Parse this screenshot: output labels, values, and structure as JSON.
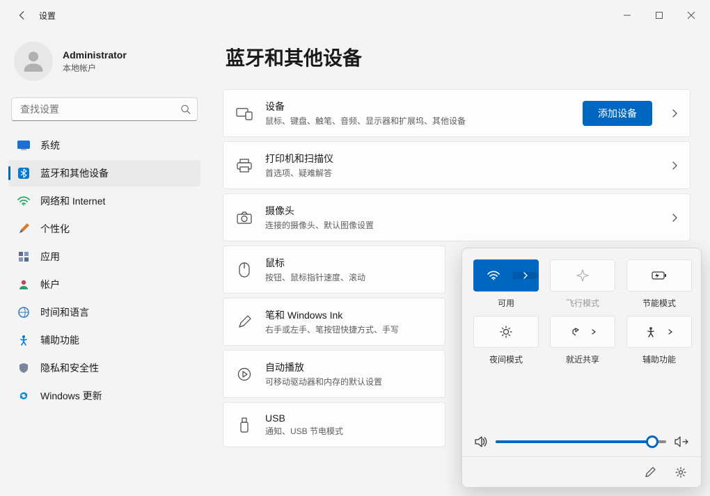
{
  "window": {
    "title": "设置"
  },
  "profile": {
    "name": "Administrator",
    "sub": "本地帐户"
  },
  "search": {
    "placeholder": "查找设置"
  },
  "nav": {
    "items": [
      {
        "label": "系统"
      },
      {
        "label": "蓝牙和其他设备"
      },
      {
        "label": "网络和 Internet"
      },
      {
        "label": "个性化"
      },
      {
        "label": "应用"
      },
      {
        "label": "帐户"
      },
      {
        "label": "时间和语言"
      },
      {
        "label": "辅助功能"
      },
      {
        "label": "隐私和安全性"
      },
      {
        "label": "Windows 更新"
      }
    ]
  },
  "page": {
    "title": "蓝牙和其他设备",
    "addButton": "添加设备",
    "sections": [
      {
        "title": "设备",
        "desc": "鼠标、键盘、触笔、音频、显示器和扩展坞、其他设备"
      },
      {
        "title": "打印机和扫描仪",
        "desc": "首选项、疑难解答"
      },
      {
        "title": "摄像头",
        "desc": "连接的摄像头、默认图像设置"
      },
      {
        "title": "鼠标",
        "desc": "按钮、鼠标指针速度、滚动"
      },
      {
        "title": "笔和 Windows Ink",
        "desc": "右手或左手、笔按钮快捷方式、手写"
      },
      {
        "title": "自动播放",
        "desc": "可移动驱动器和内存的默认设置"
      },
      {
        "title": "USB",
        "desc": "通知、USB 节电模式"
      }
    ]
  },
  "quickSettings": {
    "wifi": "可用",
    "airplane": "飞行模式",
    "battery": "节能模式",
    "night": "夜间模式",
    "share": "就近共享",
    "accessibility": "辅助功能",
    "volume": 92
  }
}
